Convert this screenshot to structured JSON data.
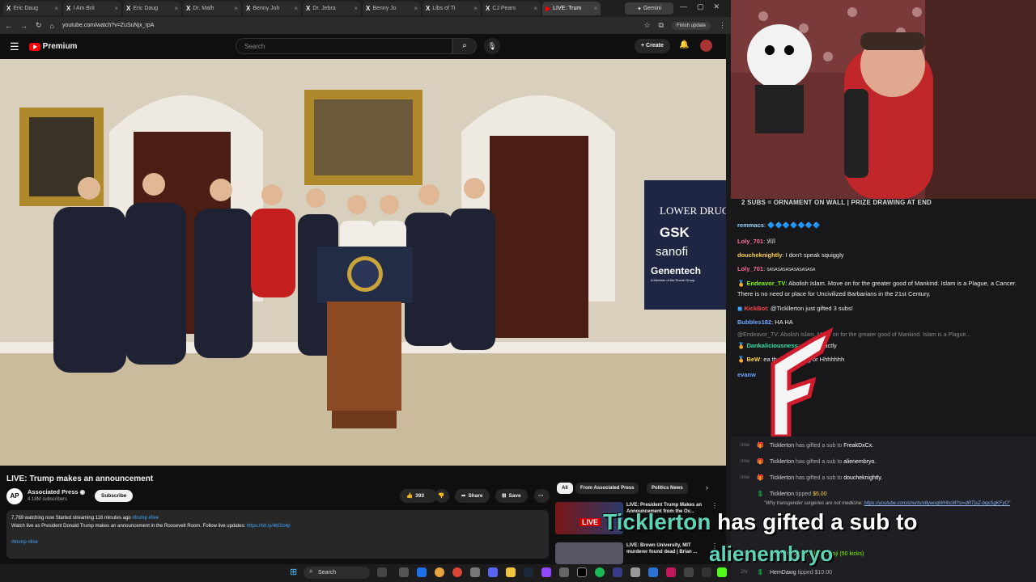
{
  "browser": {
    "tabs": [
      {
        "label": "Eric Daug"
      },
      {
        "label": "I Am Brit"
      },
      {
        "label": "Eric Daug"
      },
      {
        "label": "Dr. Malh"
      },
      {
        "label": "Benny Joh"
      },
      {
        "label": "Dr. Jebra"
      },
      {
        "label": "Benny Jo"
      },
      {
        "label": "Libs of Ti"
      },
      {
        "label": "CJ Pears"
      },
      {
        "label": "LIVE: Trum"
      }
    ],
    "gemini_tab": "Gemini",
    "url": "youtube.com/watch?v=ZuSuNjx_rpA",
    "finish_update": "Finish update"
  },
  "youtube": {
    "logo_text": "Premium",
    "search_placeholder": "Search",
    "create_label": "Create",
    "video": {
      "title": "LIVE: Trump makes an announcement",
      "channel": "Associated Press",
      "channel_initials": "AP",
      "subscribers": "4.18M subscribers",
      "subscribe_label": "Subscribe",
      "likes": "393",
      "share_label": "Share",
      "save_label": "Save",
      "desc_stats": "7,769 watching now  Started streaming 116 minutes ago",
      "desc_tags": "#trump #live",
      "desc_text": "Watch live as President Donald Trump makes an announcement in the Roosevelt Room. Follow live updates:",
      "desc_link": "https://bit.ly/4b01t4p",
      "desc_tags2": "#trump #live",
      "scene_sign": [
        "LOWER DRUG",
        "GSK",
        "sanofi",
        "Genentech",
        "A Member of the Roche Group"
      ]
    },
    "chips": [
      "All",
      "From Associated Press",
      "Politics News"
    ],
    "recommendations": [
      {
        "title": "LIVE: President Trump Makes an Announcement from the Ov...",
        "badge": "LIVE"
      },
      {
        "title": "LIVE: Brown University, MIT murderer found dead | Brian ..."
      }
    ]
  },
  "stream": {
    "banner": "2 SUBS = ORNAMENT ON WALL | PRIZE DRAWING AT END",
    "chat": [
      {
        "user": "remmacs",
        "text": "",
        "color": "#9ad3ff"
      },
      {
        "user": "Loly_701",
        "text": "ﺍﻟﺍﻻ",
        "color": "#ff6f91"
      },
      {
        "user": "doucheknightly",
        "text": "I don't speak squiggly",
        "color": "#ffd24d"
      },
      {
        "user": "Loly_701",
        "text": "SASASASASASASASASA",
        "color": "#ff6f91"
      },
      {
        "user": "Endeavor_TV",
        "text": "Abolish Islam. Move on for the greater good of Mankind. Islam is a Plague, a Cancer. There is no need or place for Uncivilized Barbarians in the 21st Century.",
        "color": "#7cfc00"
      },
      {
        "user": "KickBot",
        "text": "@Tickllerton just gifted 3 subs!",
        "color": "#ff4444"
      },
      {
        "user": "Bubbles182",
        "text": "HA HA",
        "color": "#6aa9ff"
      },
      {
        "user": "@Endeavor_TV",
        "text": "Abolish Islam. Move on for the greater good of Mankind. Islam is a Plague...",
        "color": "#888"
      },
      {
        "user": "Dankaliciousness",
        "text": "ughts exactly",
        "color": "#2ee6a8"
      },
      {
        "user": "BeW",
        "text": "ea that's laughing or Hhhhhhh",
        "color": "#ffd24d"
      },
      {
        "user": "evanw",
        "text": "",
        "color": "#6aa9ff"
      }
    ],
    "events": [
      {
        "time": "now",
        "user": "Ticklerton",
        "action": "has gifted a sub to",
        "target": "FreakDxCx."
      },
      {
        "time": "now",
        "user": "Ticklerton",
        "action": "has gifted a sub to",
        "target": "alienembryo."
      },
      {
        "time": "now",
        "user": "Ticklerton",
        "action": "has gifted a sub to",
        "target": "doucheknightly."
      },
      {
        "time": "",
        "user": "Ticklerton",
        "action": "tipped",
        "target": "$5.00"
      }
    ],
    "tip_message": "\"Why transgender surgeries are not medicine:",
    "tip_link": "https://youtube.com/shorts/v8ywoqWHhcM?si=dRTjsZ-bqxSgKFyO\"",
    "feed_more": [
      {
        "time": "2hr",
        "user": "Ladyclinks",
        "text": "sent Skull Emoji (50 kicks)"
      },
      {
        "time": "2hr",
        "user": "HemDawg",
        "text": "tipped $10.00"
      }
    ],
    "alert": {
      "user": "Ticklerton",
      "action": "has gifted a sub to",
      "target": "alienembryo"
    }
  },
  "taskbar": {
    "search_label": "Search"
  }
}
